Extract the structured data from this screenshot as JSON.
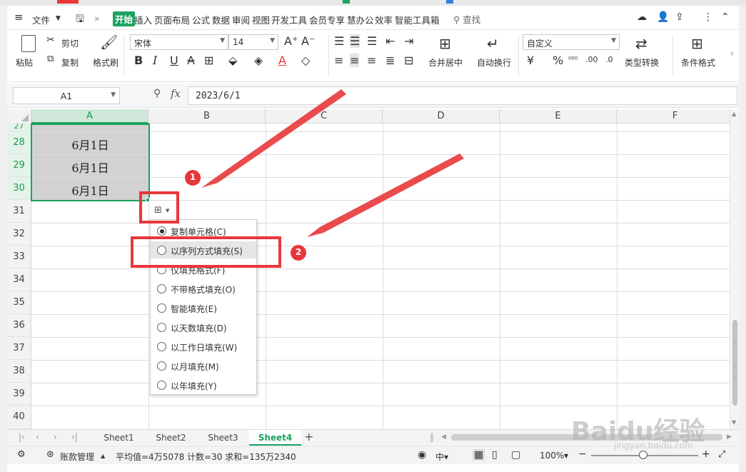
{
  "menubar": {
    "file_label": "文件",
    "tabs": [
      "开始",
      "插入",
      "页面布局",
      "公式",
      "数据",
      "审阅",
      "视图",
      "开发工具",
      "会员专享",
      "慧办公",
      "效率",
      "智能工具箱"
    ],
    "search_label": "查找"
  },
  "ribbon": {
    "paste": "粘贴",
    "cut": "剪切",
    "copy": "复制",
    "format_painter": "格式刷",
    "font_name": "宋体",
    "font_size": "14",
    "merge_center": "合并居中",
    "wrap_text": "自动换行",
    "number_format": "自定义",
    "type_convert": "类型转换",
    "conditional_format": "条件格式",
    "bold": "B",
    "italic": "I",
    "underline": "U",
    "currency": "¥",
    "percent": "%",
    "dec_inc": ".00",
    "dec_dec": ".0"
  },
  "formula_bar": {
    "cell_ref": "A1",
    "fx": "fx",
    "value": "2023/6/1"
  },
  "columns": [
    "A",
    "B",
    "C",
    "D",
    "E",
    "F"
  ],
  "rows": [
    "27",
    "28",
    "29",
    "30",
    "31",
    "32",
    "33",
    "34",
    "35",
    "36",
    "37",
    "38",
    "39",
    "40"
  ],
  "cells": {
    "a28": "6月1日",
    "a29": "6月1日",
    "a30": "6月1日"
  },
  "autofill_menu": {
    "items": [
      {
        "label": "复制单元格(C)",
        "checked": true
      },
      {
        "label": "以序列方式填充(S)",
        "checked": false
      },
      {
        "label": "仅填充格式(F)",
        "checked": false
      },
      {
        "label": "不带格式填充(O)",
        "checked": false
      },
      {
        "label": "智能填充(E)",
        "checked": false
      },
      {
        "label": "以天数填充(D)",
        "checked": false
      },
      {
        "label": "以工作日填充(W)",
        "checked": false
      },
      {
        "label": "以月填充(M)",
        "checked": false
      },
      {
        "label": "以年填充(Y)",
        "checked": false
      }
    ]
  },
  "annotations": {
    "badge1": "1",
    "badge2": "2",
    "color": "#e8373a"
  },
  "sheets": [
    "Sheet1",
    "Sheet2",
    "Sheet3",
    "Sheet4"
  ],
  "active_sheet": "Sheet4",
  "status": {
    "account": "账款管理",
    "stats": "平均值=4万5078  计数=30  求和=135万2340",
    "zoom": "100%"
  },
  "watermark": {
    "main": "Baidu经验",
    "sub": "jingyan.baidu.com"
  },
  "colors": {
    "accent": "#1ba360",
    "selection_fill": "#d2d2d2"
  }
}
